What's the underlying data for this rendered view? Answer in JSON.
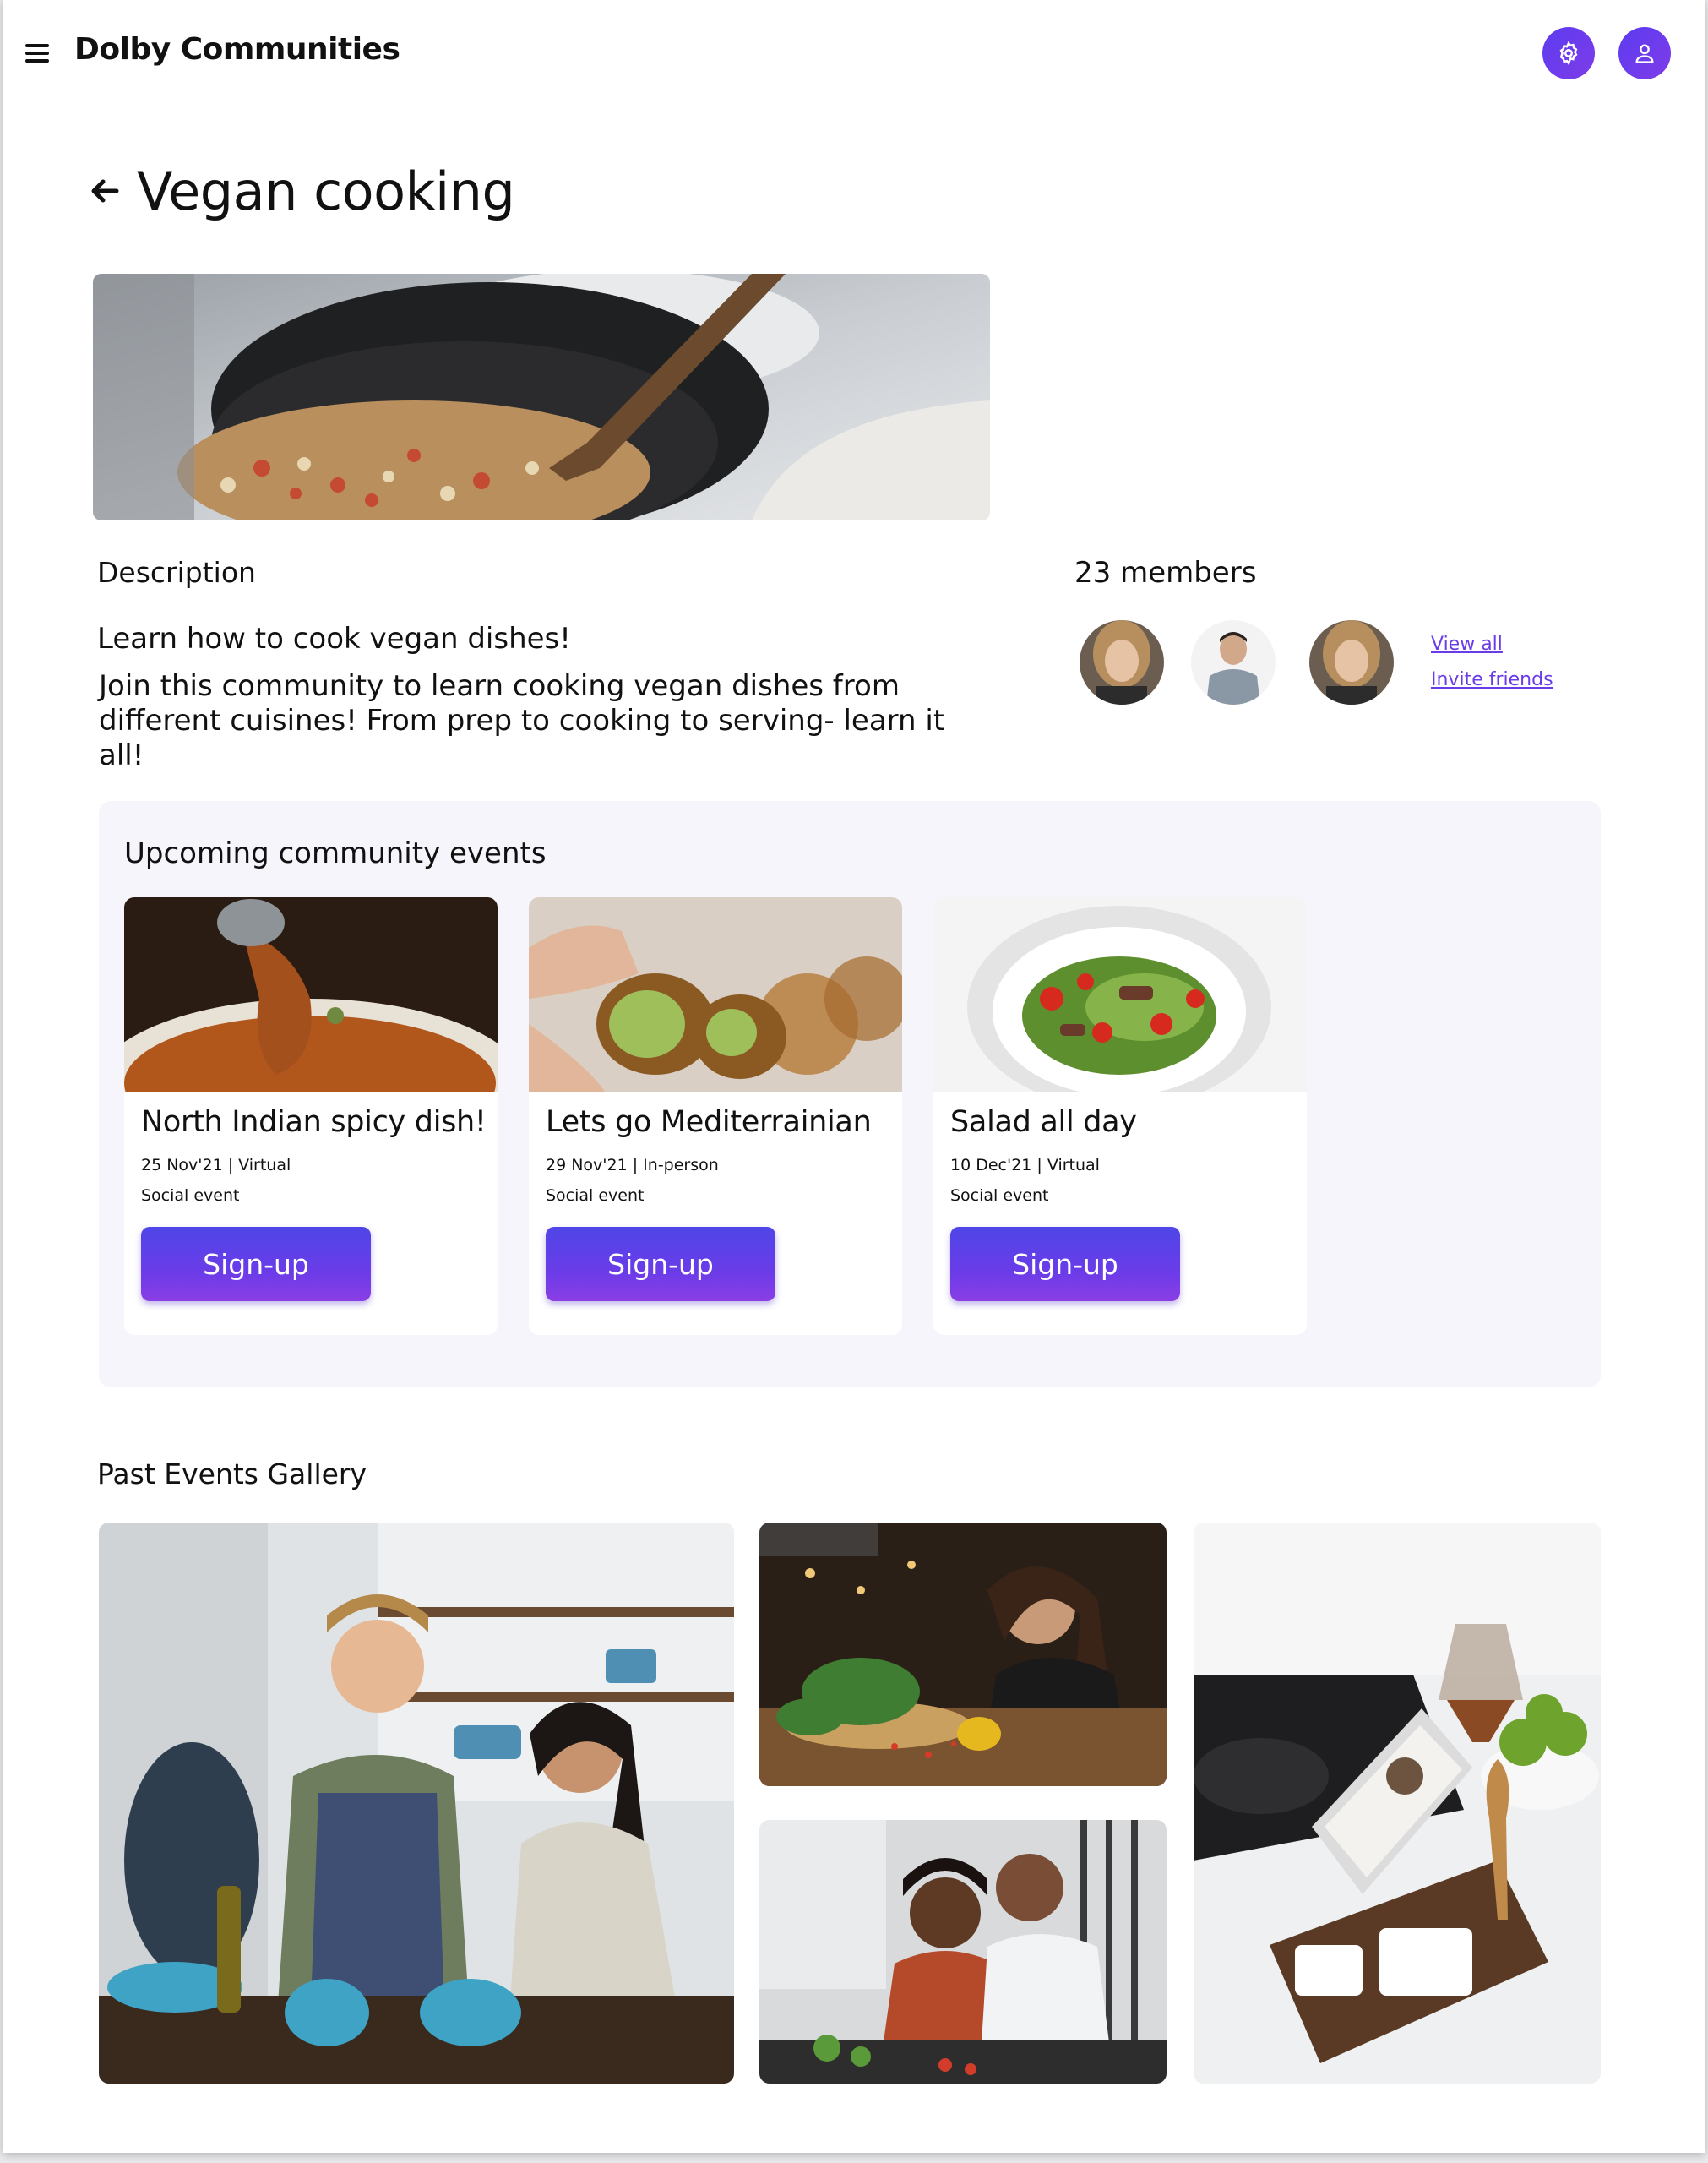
{
  "header": {
    "app_title": "Dolby Communities",
    "menu_icon": "hamburger-menu-icon",
    "settings_icon": "gear-icon",
    "profile_icon": "user-icon",
    "accent_color": "#6a3ce8"
  },
  "page": {
    "title": "Vegan cooking",
    "back_icon": "arrow-left-icon"
  },
  "description": {
    "heading": "Description",
    "line1": "Learn how to cook vegan dishes!",
    "line2": "Join this community to learn cooking vegan dishes from different cuisines! From prep to cooking to serving- learn it all!"
  },
  "members": {
    "heading": "23 members",
    "view_all": "View all",
    "invite": "Invite friends"
  },
  "events": {
    "heading": "Upcoming community events",
    "cards": [
      {
        "title": "North Indian spicy dish!",
        "meta": "25 Nov'21 | Virtual",
        "type": "Social event",
        "button": "Sign-up"
      },
      {
        "title": "Lets go Mediterrainian",
        "meta": "29 Nov'21 | In-person",
        "type": "Social event",
        "button": "Sign-up"
      },
      {
        "title": "Salad all day",
        "meta": "10 Dec'21 | Virtual",
        "type": "Social event",
        "button": "Sign-up"
      }
    ]
  },
  "gallery": {
    "heading": "Past Events Gallery"
  }
}
